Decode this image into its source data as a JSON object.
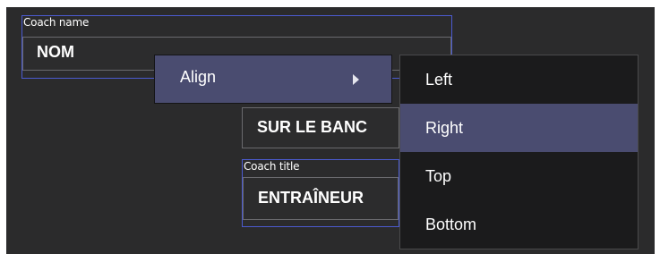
{
  "fields": {
    "coach_name": {
      "label": "Coach name",
      "value": "NOM"
    },
    "bench": {
      "value": "SUR LE BANC"
    },
    "coach_title": {
      "label": "Coach title",
      "value": "ENTRAÎNEUR"
    }
  },
  "context_menu": {
    "align_label": "Align",
    "submenu_arrow_icon": "chevron-right-icon"
  },
  "submenu": {
    "items": [
      {
        "label": "Left",
        "selected": false
      },
      {
        "label": "Right",
        "selected": true
      },
      {
        "label": "Top",
        "selected": false
      },
      {
        "label": "Bottom",
        "selected": false
      }
    ]
  },
  "colors": {
    "canvas_bg": "#2b2b2c",
    "field_outline": "#4b5bd0",
    "menu_highlight": "#4a4c70",
    "submenu_bg": "#1b1b1c"
  }
}
